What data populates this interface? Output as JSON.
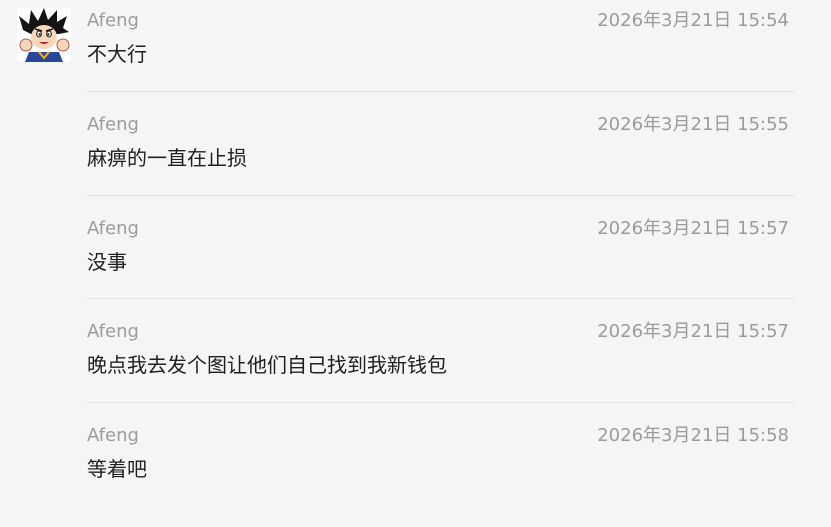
{
  "messages": [
    {
      "sender": "Afeng",
      "time": "2026年3月21日 15:54",
      "text": "不大行"
    },
    {
      "sender": "Afeng",
      "time": "2026年3月21日 15:55",
      "text": "麻痹的一直在止损"
    },
    {
      "sender": "Afeng",
      "time": "2026年3月21日 15:57",
      "text": "没事"
    },
    {
      "sender": "Afeng",
      "time": "2026年3月21日 15:57",
      "text": "晚点我去发个图让他们自己找到我新钱包"
    },
    {
      "sender": "Afeng",
      "time": "2026年3月21日 15:58",
      "text": "等着吧"
    }
  ],
  "avatar": {
    "icon": "cartoon-boy-avatar-icon"
  },
  "colors": {
    "background": "#f5f5f5",
    "meta_text": "#9b9b9b",
    "message_text": "#1f1f1f",
    "divider": "#e4e4e4"
  }
}
